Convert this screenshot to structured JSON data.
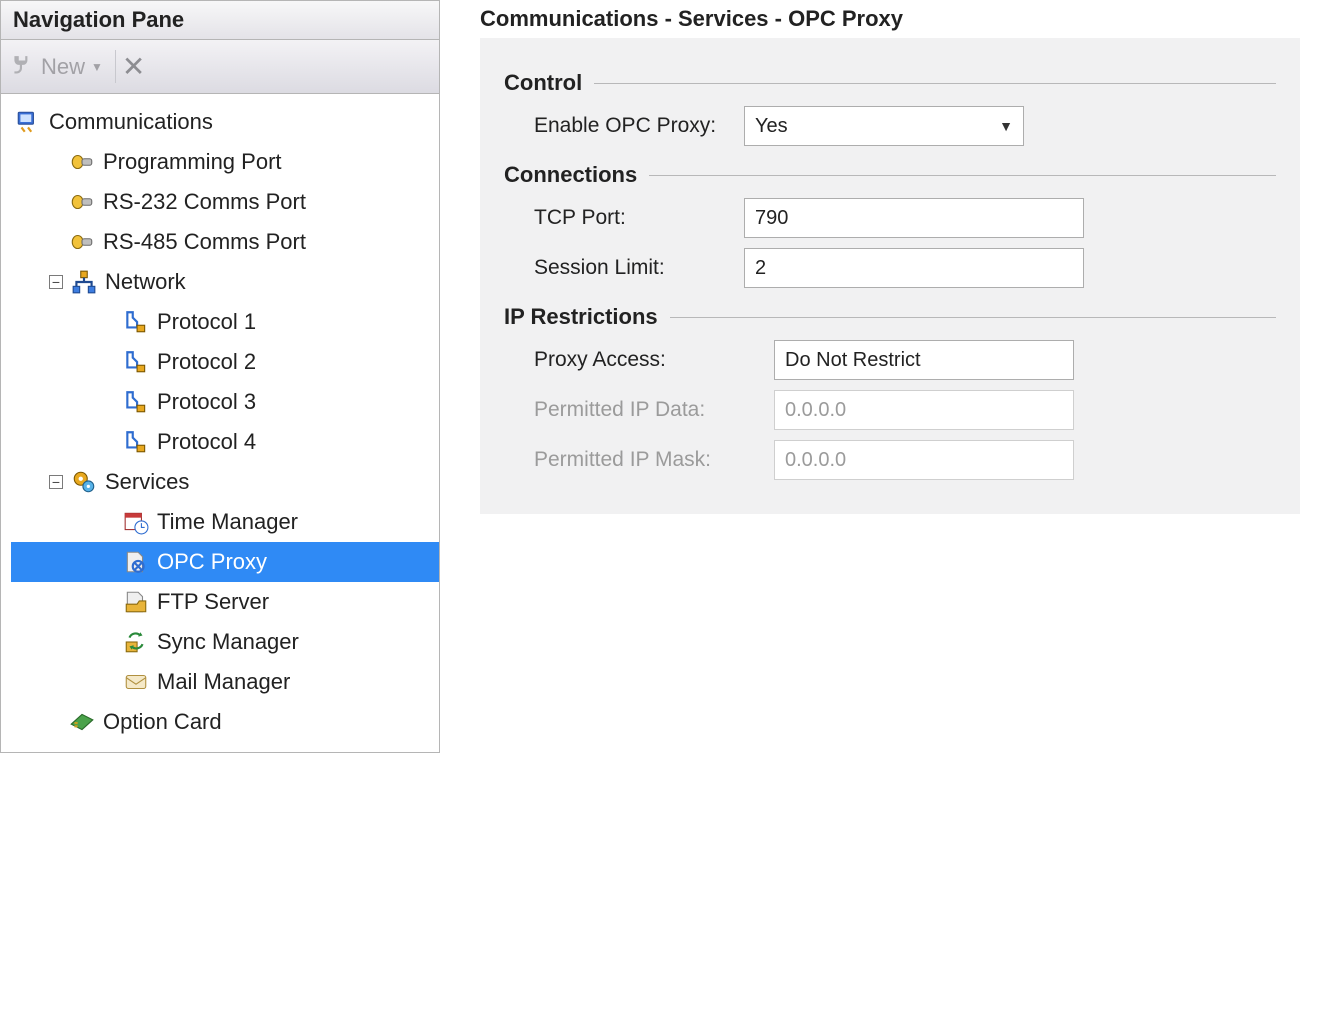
{
  "sidebar": {
    "title": "Navigation Pane",
    "new_label": "New",
    "tree": {
      "root": "Communications",
      "ports": [
        "Programming Port",
        "RS-232 Comms Port",
        "RS-485 Comms Port"
      ],
      "network": {
        "label": "Network",
        "protocols": [
          "Protocol 1",
          "Protocol 2",
          "Protocol 3",
          "Protocol 4"
        ]
      },
      "services": {
        "label": "Services",
        "items": [
          "Time Manager",
          "OPC Proxy",
          "FTP Server",
          "Sync Manager",
          "Mail Manager"
        ]
      },
      "option_card": "Option Card"
    }
  },
  "breadcrumb": "Communications - Services - OPC Proxy",
  "panel": {
    "sections": {
      "control": {
        "title": "Control",
        "enable_label": "Enable OPC Proxy:",
        "enable_value": "Yes"
      },
      "connections": {
        "title": "Connections",
        "tcp_port_label": "TCP Port:",
        "tcp_port_value": "790",
        "session_limit_label": "Session Limit:",
        "session_limit_value": "2"
      },
      "ip_restrictions": {
        "title": "IP Restrictions",
        "proxy_access_label": "Proxy Access:",
        "proxy_access_value": "Do Not Restrict",
        "ip_data_label": "Permitted IP Data:",
        "ip_data_value": "0.0.0.0",
        "ip_mask_label": "Permitted IP Mask:",
        "ip_mask_value": "0.0.0.0"
      }
    }
  }
}
